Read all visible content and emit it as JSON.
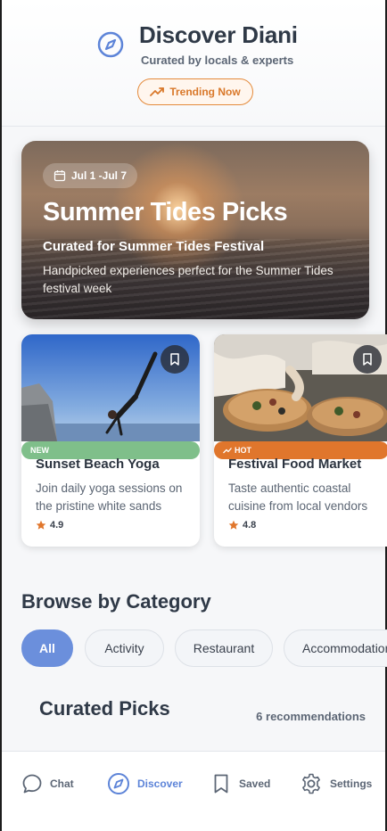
{
  "header": {
    "title": "Discover Diani",
    "subtitle": "Curated by locals & experts",
    "trending_label": "Trending Now"
  },
  "hero": {
    "date_range": "Jul 1 -Jul 7",
    "title": "Summer Tides Picks",
    "subtitle": "Curated for Summer Tides Festival",
    "description": "Handpicked experiences perfect for the Summer Tides festival week"
  },
  "cards": [
    {
      "badge": "NEW",
      "title": "Sunset Beach Yoga",
      "description": "Join daily yoga sessions on the pristine white sands",
      "rating": "4.9",
      "badge_color": "#7fbf8a"
    },
    {
      "badge": "HOT",
      "title": "Festival Food Market",
      "description": "Taste authentic coastal cuisine from local vendors",
      "rating": "4.8",
      "badge_color": "#e0762c"
    }
  ],
  "browse": {
    "title": "Browse by Category",
    "chips": [
      "All",
      "Activity",
      "Restaurant",
      "Accommodation"
    ],
    "selected": "All"
  },
  "picks": {
    "title": "Curated Picks",
    "count": "6 recommendations"
  },
  "tabbar": {
    "items": [
      {
        "label": "Chat",
        "icon": "chat-bubble-icon"
      },
      {
        "label": "Discover",
        "icon": "compass-icon",
        "active": true
      },
      {
        "label": "Saved",
        "icon": "bookmark-icon"
      },
      {
        "label": "Settings",
        "icon": "gear-icon"
      }
    ]
  },
  "colors": {
    "accent": "#5d84d8",
    "trending": "#e48a3b",
    "star": "#e0762c"
  }
}
